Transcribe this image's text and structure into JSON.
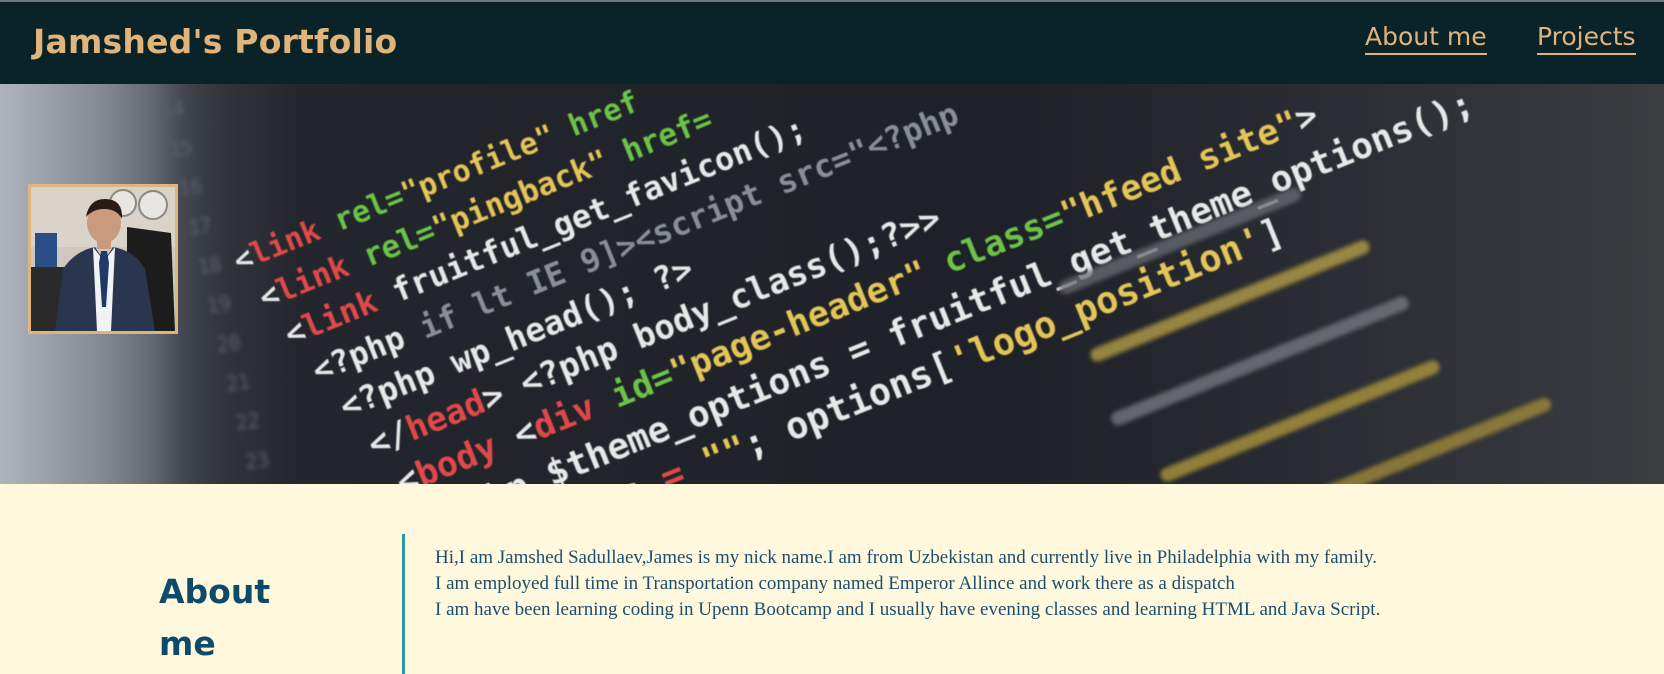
{
  "header": {
    "brand": "Jamshed's Portfolio",
    "nav": [
      {
        "label": "About me"
      },
      {
        "label": "Projects"
      }
    ]
  },
  "hero": {
    "image": "code-editor-background",
    "avatar": "profile-photo",
    "code_lines": [
      "rel=\"profile\" href",
      "rel=\"pingback\" href=",
      "<link fruitful_get_favicon();",
      "<?php if lt IE 9]><script src=\"<?php",
      "<?php wp_head(); ?>",
      "</head> <?php body_class();?>>",
      "<body <div id=\"page-header\" class=\"hfeed site\">",
      "$theme_options = fruitful_get_theme_options();",
      "$menu_pos = \"\";",
      "options['logo_position']"
    ]
  },
  "about": {
    "title": "About me",
    "paragraphs": [
      "Hi,I am Jamshed Sadullaev,James is my nick name.I am from Uzbekistan and currently live in Philadelphia with my family.",
      "I am employed full time in Transportation company named Emperor Allince and work there as a dispatch",
      "I am have been learning coding in Upenn Bootcamp and I usually have evening classes and learning HTML and Java Script."
    ]
  },
  "colors": {
    "header_bg": "#0a2328",
    "accent": "#e1b47c",
    "page_bg": "#fff8dc",
    "heading": "#0e4a6a",
    "divider": "#2a9aa0"
  }
}
